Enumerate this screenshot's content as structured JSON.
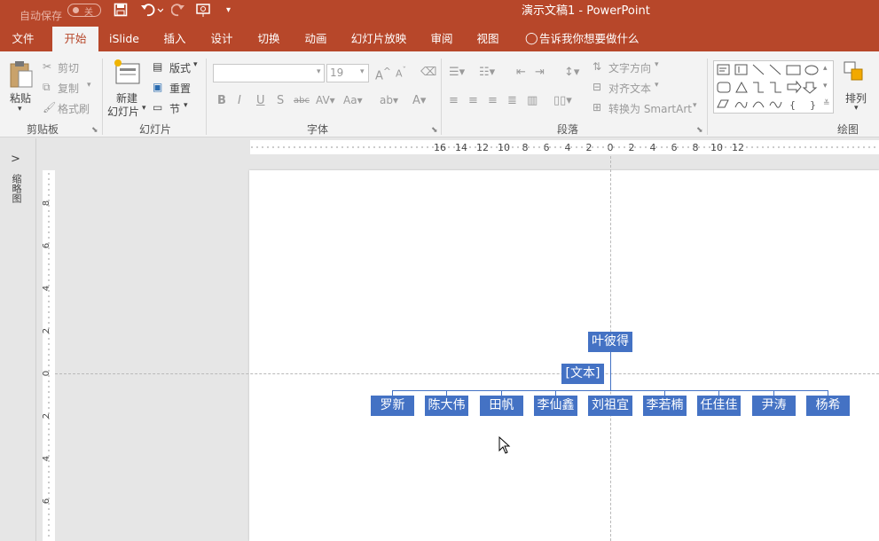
{
  "titlebar": {
    "autosave_label": "自动保存",
    "autosave_state": "关",
    "doc_title": "演示文稿1  -  PowerPoint"
  },
  "tabs": [
    {
      "label": "文件"
    },
    {
      "label": "开始"
    },
    {
      "label": "iSlide"
    },
    {
      "label": "插入"
    },
    {
      "label": "设计"
    },
    {
      "label": "切换"
    },
    {
      "label": "动画"
    },
    {
      "label": "幻灯片放映"
    },
    {
      "label": "审阅"
    },
    {
      "label": "视图"
    },
    {
      "label": "告诉我你想要做什么"
    }
  ],
  "ribbon": {
    "clipboard": {
      "paste": "粘贴",
      "cut": "剪切",
      "copy": "复制",
      "format_painter": "格式刷",
      "group": "剪贴板"
    },
    "slides": {
      "new_slide_1": "新建",
      "new_slide_2": "幻灯片",
      "layout": "版式",
      "reset": "重置",
      "section": "节",
      "group": "幻灯片"
    },
    "font": {
      "font_name": "",
      "font_size": "19",
      "group": "字体"
    },
    "paragraph": {
      "text_direction": "文字方向",
      "align_text": "对齐文本",
      "convert_smartart": "转换为 SmartArt",
      "group": "段落"
    },
    "drawing": {
      "arrange": "排列",
      "group": "绘图"
    }
  },
  "sidebar": {
    "thumbnail_label": "缩略图"
  },
  "hruler_labels": [
    "16",
    "14",
    "12",
    "10",
    "8",
    "6",
    "4",
    "2",
    "0",
    "2",
    "4",
    "6",
    "8",
    "10",
    "12"
  ],
  "vruler_labels": [
    "8",
    "6",
    "4",
    "2",
    "0",
    "2",
    "4",
    "6"
  ],
  "org_chart": {
    "root": "叶彼得",
    "assistant": "[文本]",
    "children": [
      "罗新",
      "陈大伟",
      "田帆",
      "李仙鑫",
      "刘祖宜",
      "李若楠",
      "任佳佳",
      "尹涛",
      "杨希"
    ]
  }
}
